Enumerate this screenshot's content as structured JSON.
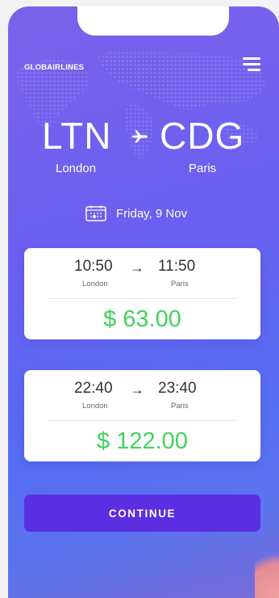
{
  "app": {
    "brand": "GLOBAIRLINES",
    "menu_icon": "hamburger-menu-icon"
  },
  "route": {
    "origin_code": "LTN",
    "origin_city": "London",
    "destination_code": "CDG",
    "destination_city": "Paris",
    "separator_icon": "airplane-icon"
  },
  "date": {
    "label": "Friday, 9 Nov",
    "icon": "calendar-icon"
  },
  "flights": [
    {
      "departure_time": "10:50",
      "arrival_time": "11:50",
      "departure_city": "London",
      "arrival_city": "Paris",
      "price": "$ 63.00",
      "arrow": "→"
    },
    {
      "departure_time": "22:40",
      "arrival_time": "23:40",
      "departure_city": "London",
      "arrival_city": "Paris",
      "price": "$ 122.00",
      "arrow": "→"
    }
  ],
  "actions": {
    "continue_label": "CONTINUE"
  },
  "colors": {
    "background_gradient_start": "#7b62ea",
    "background_gradient_end": "#556df2",
    "price_green": "#43d25d",
    "button_purple": "#5b2ee2",
    "card_white": "#ffffff"
  }
}
